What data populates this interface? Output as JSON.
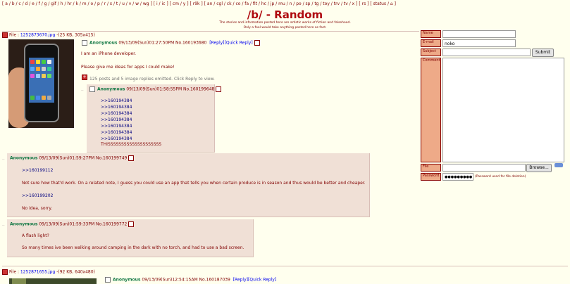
{
  "nav": "[ a / b / c / d / e / f / g / gif / h / hr / k / m / o / p / r / s / t / u / v / w / wg ] [ i / ic ] [ cm / y ] [ r9k ] [ an / cgl / ck / co / fa / fit / hc / jp / mu / n / po / sp / tg / toy / trv / tv / x ] [ rs ] [ status / ⌂ ]",
  "board": {
    "title": "/b/ - Random",
    "tagline1": "The stories and information posted here are artistic works of fiction and falsehood.",
    "tagline2": "Only a fool would take anything posted here as fact."
  },
  "thread1": {
    "file_prefix": "File : ",
    "file_link": "1252873670.jpg",
    "file_info": "-(25 KB, 305x415)",
    "name": "Anonymous",
    "date": "09/13/09(Sun)01:27:50PM No.160193680",
    "reply_link": "[Reply]",
    "quick_link": "[Quick Reply]",
    "lines": [
      "I am an iPhone developer.",
      "Please give me ideas for apps I could make!"
    ],
    "omitted": "125 posts and 5 image replies omitted. Click Reply to view."
  },
  "replies": [
    {
      "name": "Anonymous",
      "meta": "09/13/09(Sun)01:58:55PM No.160199648",
      "quotes": [
        ">>160194384",
        ">>160194384",
        ">>160194384",
        ">>160194384",
        ">>160194384",
        ">>160194384",
        ">>160194384"
      ],
      "text": "THISSSSSSSSSSSSSSSSSSSS"
    },
    {
      "name": "Anonymous",
      "meta": "09/13/09(Sun)01:59:27PM No.160199749",
      "quote1": ">>160199112",
      "text1": "Not sure how that'd work. On a related note, I guess you could use an app that tells you when certain produce is in season and thus would be better and cheaper.",
      "quote2": ">>160199202",
      "text2": "No idea, sorry."
    },
    {
      "name": "Anonymous",
      "meta": "09/13/09(Sun)01:59:33PM No.160199772",
      "text1": "A flash light?",
      "text2": "So many times ive been walking around camping in the dark with no torch, and had to use a bad screen."
    }
  ],
  "thread2": {
    "file_prefix": "File : ",
    "file_link": "1252871655.jpg",
    "file_info": "-(92 KB, 640x480)",
    "name": "Anonymous",
    "date": "09/13/09(Sun)12:54:15AM No.160187039",
    "reply_link": "[Reply]",
    "quick_link": "[Quick Reply]"
  },
  "form": {
    "name_label": "Name",
    "email_label": "E-mail",
    "email_value": "noko",
    "subject_label": "Subject",
    "submit_label": "Submit",
    "comment_label": "Comment",
    "file_label": "File",
    "browse_label": "Browse...",
    "password_label": "Password",
    "password_value": "●●●●●●●●●",
    "password_note": "(Password used for file deletion)"
  },
  "colors": {
    "background": "#FFFFEE",
    "reply_bg": "#F0E0D6",
    "name": "#117743",
    "title": "#AF0A0F",
    "text": "#800000",
    "quote": "#000080"
  }
}
